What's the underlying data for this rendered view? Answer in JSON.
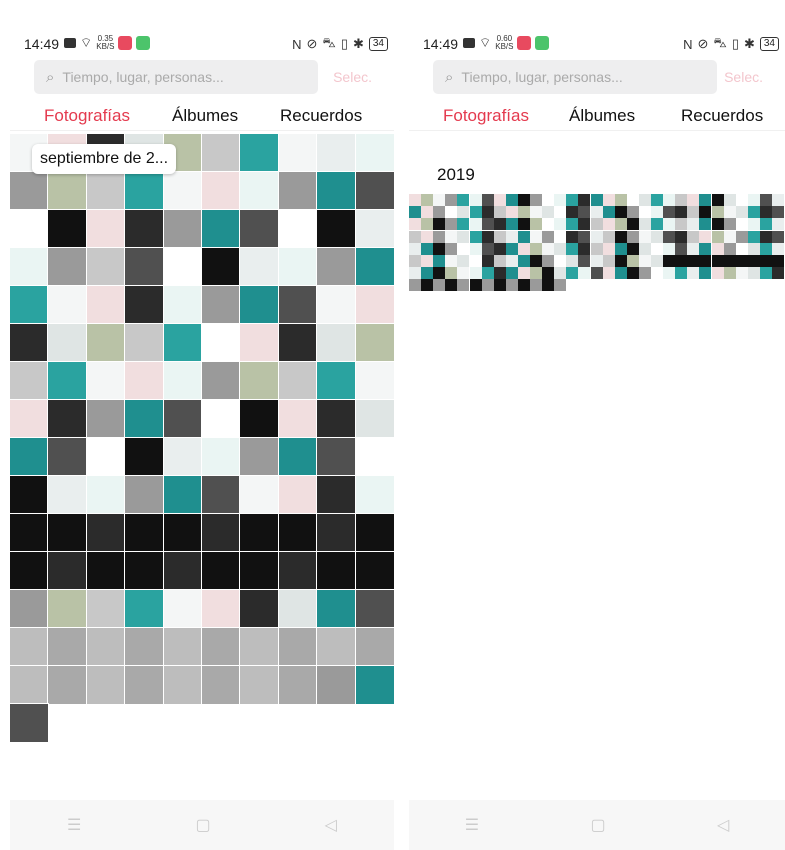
{
  "screens": [
    {
      "status": {
        "time": "14:49",
        "speed": "0.35",
        "speed_unit": "KB/S",
        "battery": "34"
      },
      "search_placeholder": "Tiempo, lugar, personas...",
      "select_label": "Selec.",
      "tabs": [
        "Fotografías",
        "Álbumes",
        "Recuerdos"
      ],
      "active_tab": 0,
      "date_chip": "septiembre de 2..."
    },
    {
      "status": {
        "time": "14:49",
        "speed": "0.60",
        "speed_unit": "KB/S",
        "battery": "34"
      },
      "search_placeholder": "Tiempo, lugar, personas...",
      "select_label": "Selec.",
      "tabs": [
        "Fotografías",
        "Álbumes",
        "Recuerdos"
      ],
      "active_tab": 0,
      "year_label": "2019"
    }
  ],
  "nav": {
    "menu_icon": "menu-icon",
    "home_icon": "home-icon",
    "back_icon": "back-icon"
  },
  "colors": {
    "accent": "#e43a4e",
    "teal": "#1f8f8f",
    "dark": "#111111"
  }
}
